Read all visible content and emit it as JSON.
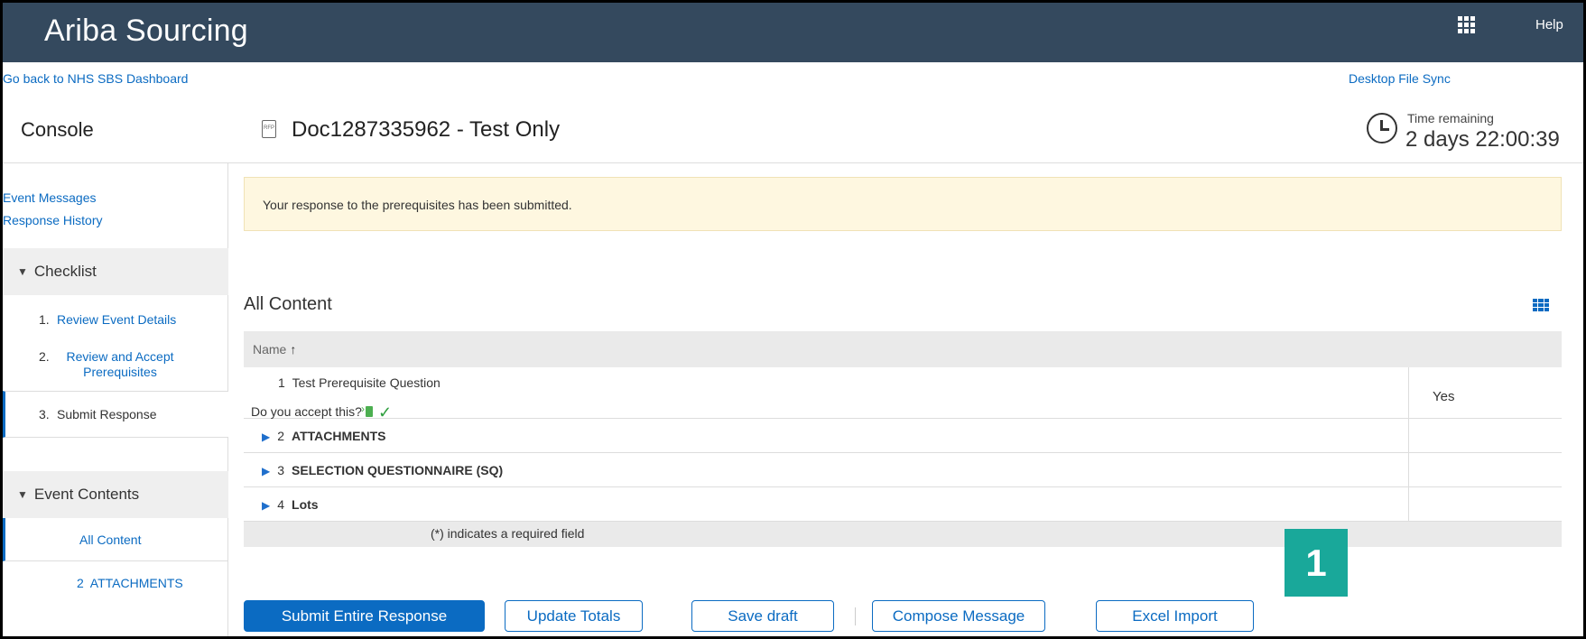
{
  "header": {
    "brand": "Ariba Sourcing",
    "help": "Help"
  },
  "links": {
    "back": "Go back to NHS SBS Dashboard",
    "sync": "Desktop File Sync"
  },
  "console": {
    "title": "Console",
    "doc_title": "Doc1287335962 - Test Only",
    "time_label": "Time remaining",
    "time_value": "2 days 22:00:39"
  },
  "sidebar": {
    "event_messages": "Event Messages",
    "response_history": "Response History",
    "checklist": "Checklist",
    "steps": [
      {
        "num": "1.",
        "label": "Review Event Details"
      },
      {
        "num": "2.",
        "label": "Review and Accept Prerequisites"
      },
      {
        "num": "3.",
        "label": "Submit Response"
      }
    ],
    "event_contents": "Event Contents",
    "event_items": [
      "All Content",
      "2  ATTACHMENTS"
    ]
  },
  "notice": "Your response to the prerequisites has been submitted.",
  "content": {
    "title": "All Content",
    "column_name": "Name",
    "sort_arrow": "↑",
    "rows": [
      {
        "index": "1",
        "name": "Test Prerequisite Question",
        "question": "Do you accept this?",
        "answer": "Yes"
      },
      {
        "index": "2",
        "name": "ATTACHMENTS"
      },
      {
        "index": "3",
        "name": "SELECTION QUESTIONNAIRE (SQ)"
      },
      {
        "index": "4",
        "name": "Lots"
      }
    ],
    "footnote": "(*) indicates a required field"
  },
  "buttons": {
    "submit": "Submit Entire Response",
    "update": "Update Totals",
    "save": "Save draft",
    "compose": "Compose Message",
    "excel": "Excel Import"
  },
  "badge": "1",
  "colors": {
    "header_bg": "#34495e",
    "link": "#0b6bc2",
    "notice_bg": "#fef7e0",
    "badge": "#19a89a"
  },
  "icons": [
    "apps-grid-icon",
    "rfp-document-icon",
    "clock-icon",
    "table-view-icon",
    "expand-triangle-icon",
    "required-flag-icon",
    "check-icon"
  ]
}
